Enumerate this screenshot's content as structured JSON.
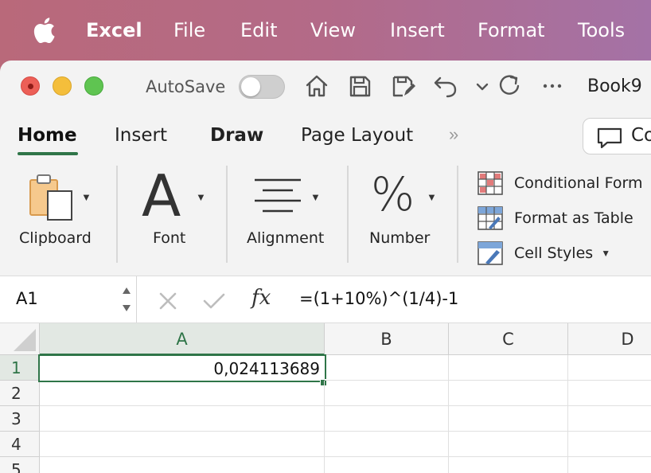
{
  "menubar": {
    "app_name": "Excel",
    "items": [
      "File",
      "Edit",
      "View",
      "Insert",
      "Format",
      "Tools"
    ]
  },
  "titlebar": {
    "autosave_label": "AutoSave",
    "autosave_on": false,
    "document_title": "Book9"
  },
  "tabs": {
    "items": [
      "Home",
      "Insert",
      "Draw",
      "Page Layout"
    ],
    "active": "Home",
    "overflow_symbol": "»",
    "comments_label": "Co"
  },
  "ribbon": {
    "clipboard_label": "Clipboard",
    "font_label": "Font",
    "font_glyph": "A",
    "alignment_label": "Alignment",
    "number_label": "Number",
    "number_glyph": "%",
    "styles": [
      "Conditional Form",
      "Format as Table",
      "Cell Styles"
    ]
  },
  "formula_bar": {
    "name_box": "A1",
    "fx_label": "fx",
    "formula": "=(1+10%)^(1/4)-1"
  },
  "grid": {
    "columns": [
      "A",
      "B",
      "C",
      "D"
    ],
    "rows": [
      "1",
      "2",
      "3",
      "4",
      "5"
    ],
    "cells": {
      "A1": "0,024113689"
    }
  },
  "colors": {
    "accent": "#2f7548",
    "menubar_gradient_start": "#b9697a",
    "menubar_gradient_end": "#a472a6"
  }
}
